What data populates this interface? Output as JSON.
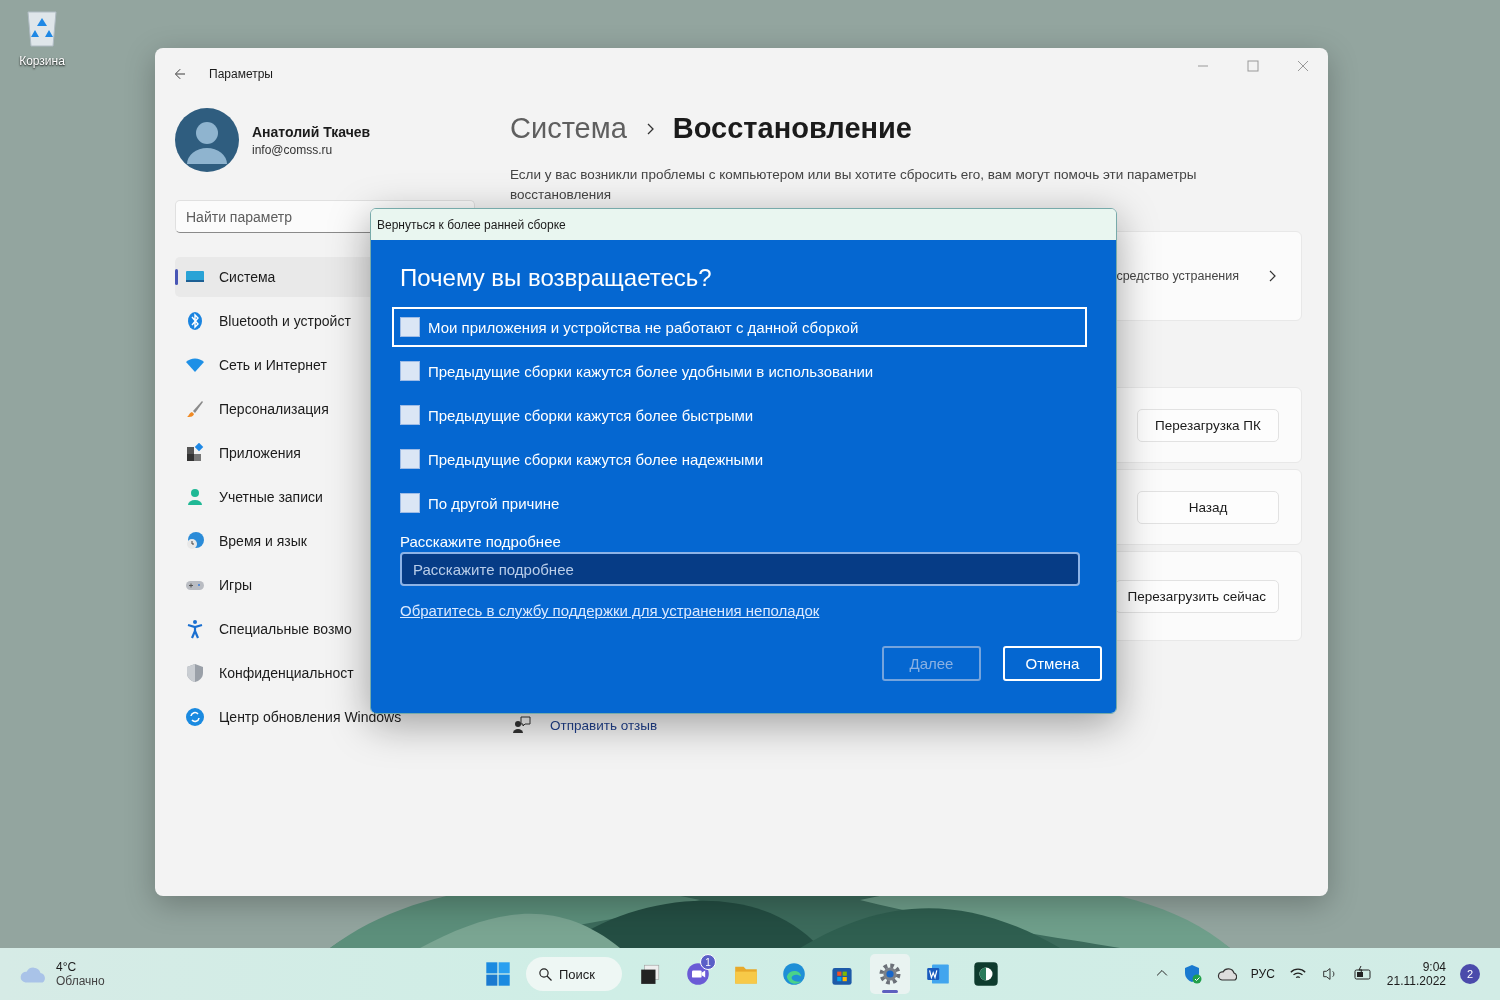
{
  "desktop": {
    "icons": [
      {
        "label": "Корзина"
      }
    ]
  },
  "settings": {
    "title": "Параметры",
    "profile": {
      "name": "Анатолий Ткачев",
      "email": "info@comss.ru"
    },
    "search": {
      "placeholder": "Найти параметр"
    },
    "nav": [
      {
        "label": "Система",
        "selected": true
      },
      {
        "label": "Bluetooth и устройст",
        "selected": false
      },
      {
        "label": "Сеть и Интернет",
        "selected": false
      },
      {
        "label": "Персонализация",
        "selected": false
      },
      {
        "label": "Приложения",
        "selected": false
      },
      {
        "label": "Учетные записи",
        "selected": false
      },
      {
        "label": "Время и язык",
        "selected": false
      },
      {
        "label": "Игры",
        "selected": false
      },
      {
        "label": "Специальные возмо",
        "selected": false
      },
      {
        "label": "Конфиденциальност",
        "selected": false
      },
      {
        "label": "Центр обновления Windows",
        "selected": false
      }
    ],
    "breadcrumb": {
      "parent": "Система",
      "current": "Восстановление"
    },
    "description": "Если у вас возникли проблемы с компьютером или вы хотите сбросить его, вам могут помочь эти параметры восстановления",
    "cards": [
      {
        "kind": "link",
        "text": "средство устранения"
      },
      {
        "kind": "button",
        "text": "Перезагрузка ПК"
      },
      {
        "kind": "button",
        "text": "Назад"
      },
      {
        "kind": "button",
        "text": "Перезагрузить сейчас"
      }
    ],
    "feedback": "Отправить отзыв"
  },
  "dialog": {
    "title": "Вернуться к более ранней сборке",
    "heading": "Почему вы возвращаетесь?",
    "options": [
      {
        "label": "Мои приложения и устройства не работают с данной сборкой",
        "checked": false,
        "focused": true
      },
      {
        "label": "Предыдущие сборки кажутся более удобными в использовании",
        "checked": false,
        "focused": false
      },
      {
        "label": "Предыдущие сборки кажутся более быстрыми",
        "checked": false,
        "focused": false
      },
      {
        "label": "Предыдущие сборки кажутся более надежными",
        "checked": false,
        "focused": false
      },
      {
        "label": "По другой причине",
        "checked": false,
        "focused": false
      }
    ],
    "details_label": "Расскажите подробнее",
    "details_placeholder": "Расскажите подробнее",
    "support_link": "Обратитесь в службу поддержки для устранения неполадок",
    "buttons": [
      {
        "label": "Далее",
        "disabled": true
      },
      {
        "label": "Отмена",
        "disabled": false
      }
    ]
  },
  "taskbar": {
    "weather": {
      "temperature": "4°C",
      "condition": "Облачно"
    },
    "search": "Поиск",
    "apps": [
      {
        "selected": false
      },
      {
        "selected": false,
        "badge": "1"
      },
      {
        "selected": false
      },
      {
        "selected": false
      },
      {
        "selected": false
      },
      {
        "selected": true
      },
      {
        "selected": false
      },
      {
        "selected": false
      }
    ],
    "language": "РУС",
    "time": "9:04",
    "date": "21.11.2022",
    "notifications": "2"
  }
}
